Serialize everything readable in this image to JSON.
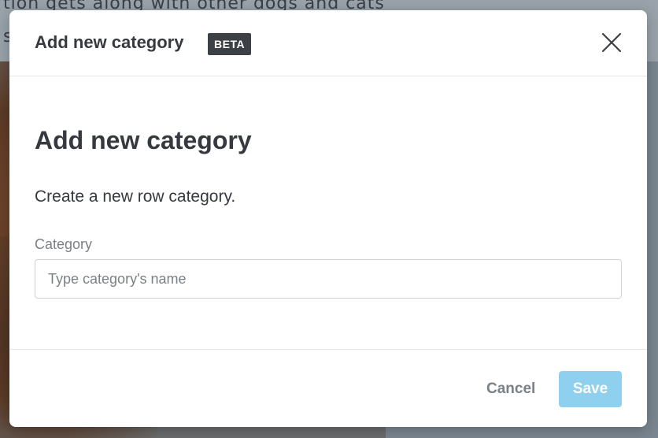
{
  "background": {
    "text_line1": "tion gets along with other dogs and cats",
    "text_line2": "s"
  },
  "modal": {
    "header": {
      "title": "Add new category",
      "badge": "BETA",
      "close_icon": "close-icon"
    },
    "body": {
      "heading": "Add new category",
      "description": "Create a new row category.",
      "field": {
        "label": "Category",
        "placeholder": "Type category's name",
        "value": ""
      }
    },
    "footer": {
      "cancel_label": "Cancel",
      "save_label": "Save",
      "save_disabled": true
    }
  },
  "colors": {
    "accent_disabled": "#8fd0ef",
    "badge_bg": "#3d4045",
    "text_primary": "#36393e",
    "text_muted": "#7b8086"
  }
}
